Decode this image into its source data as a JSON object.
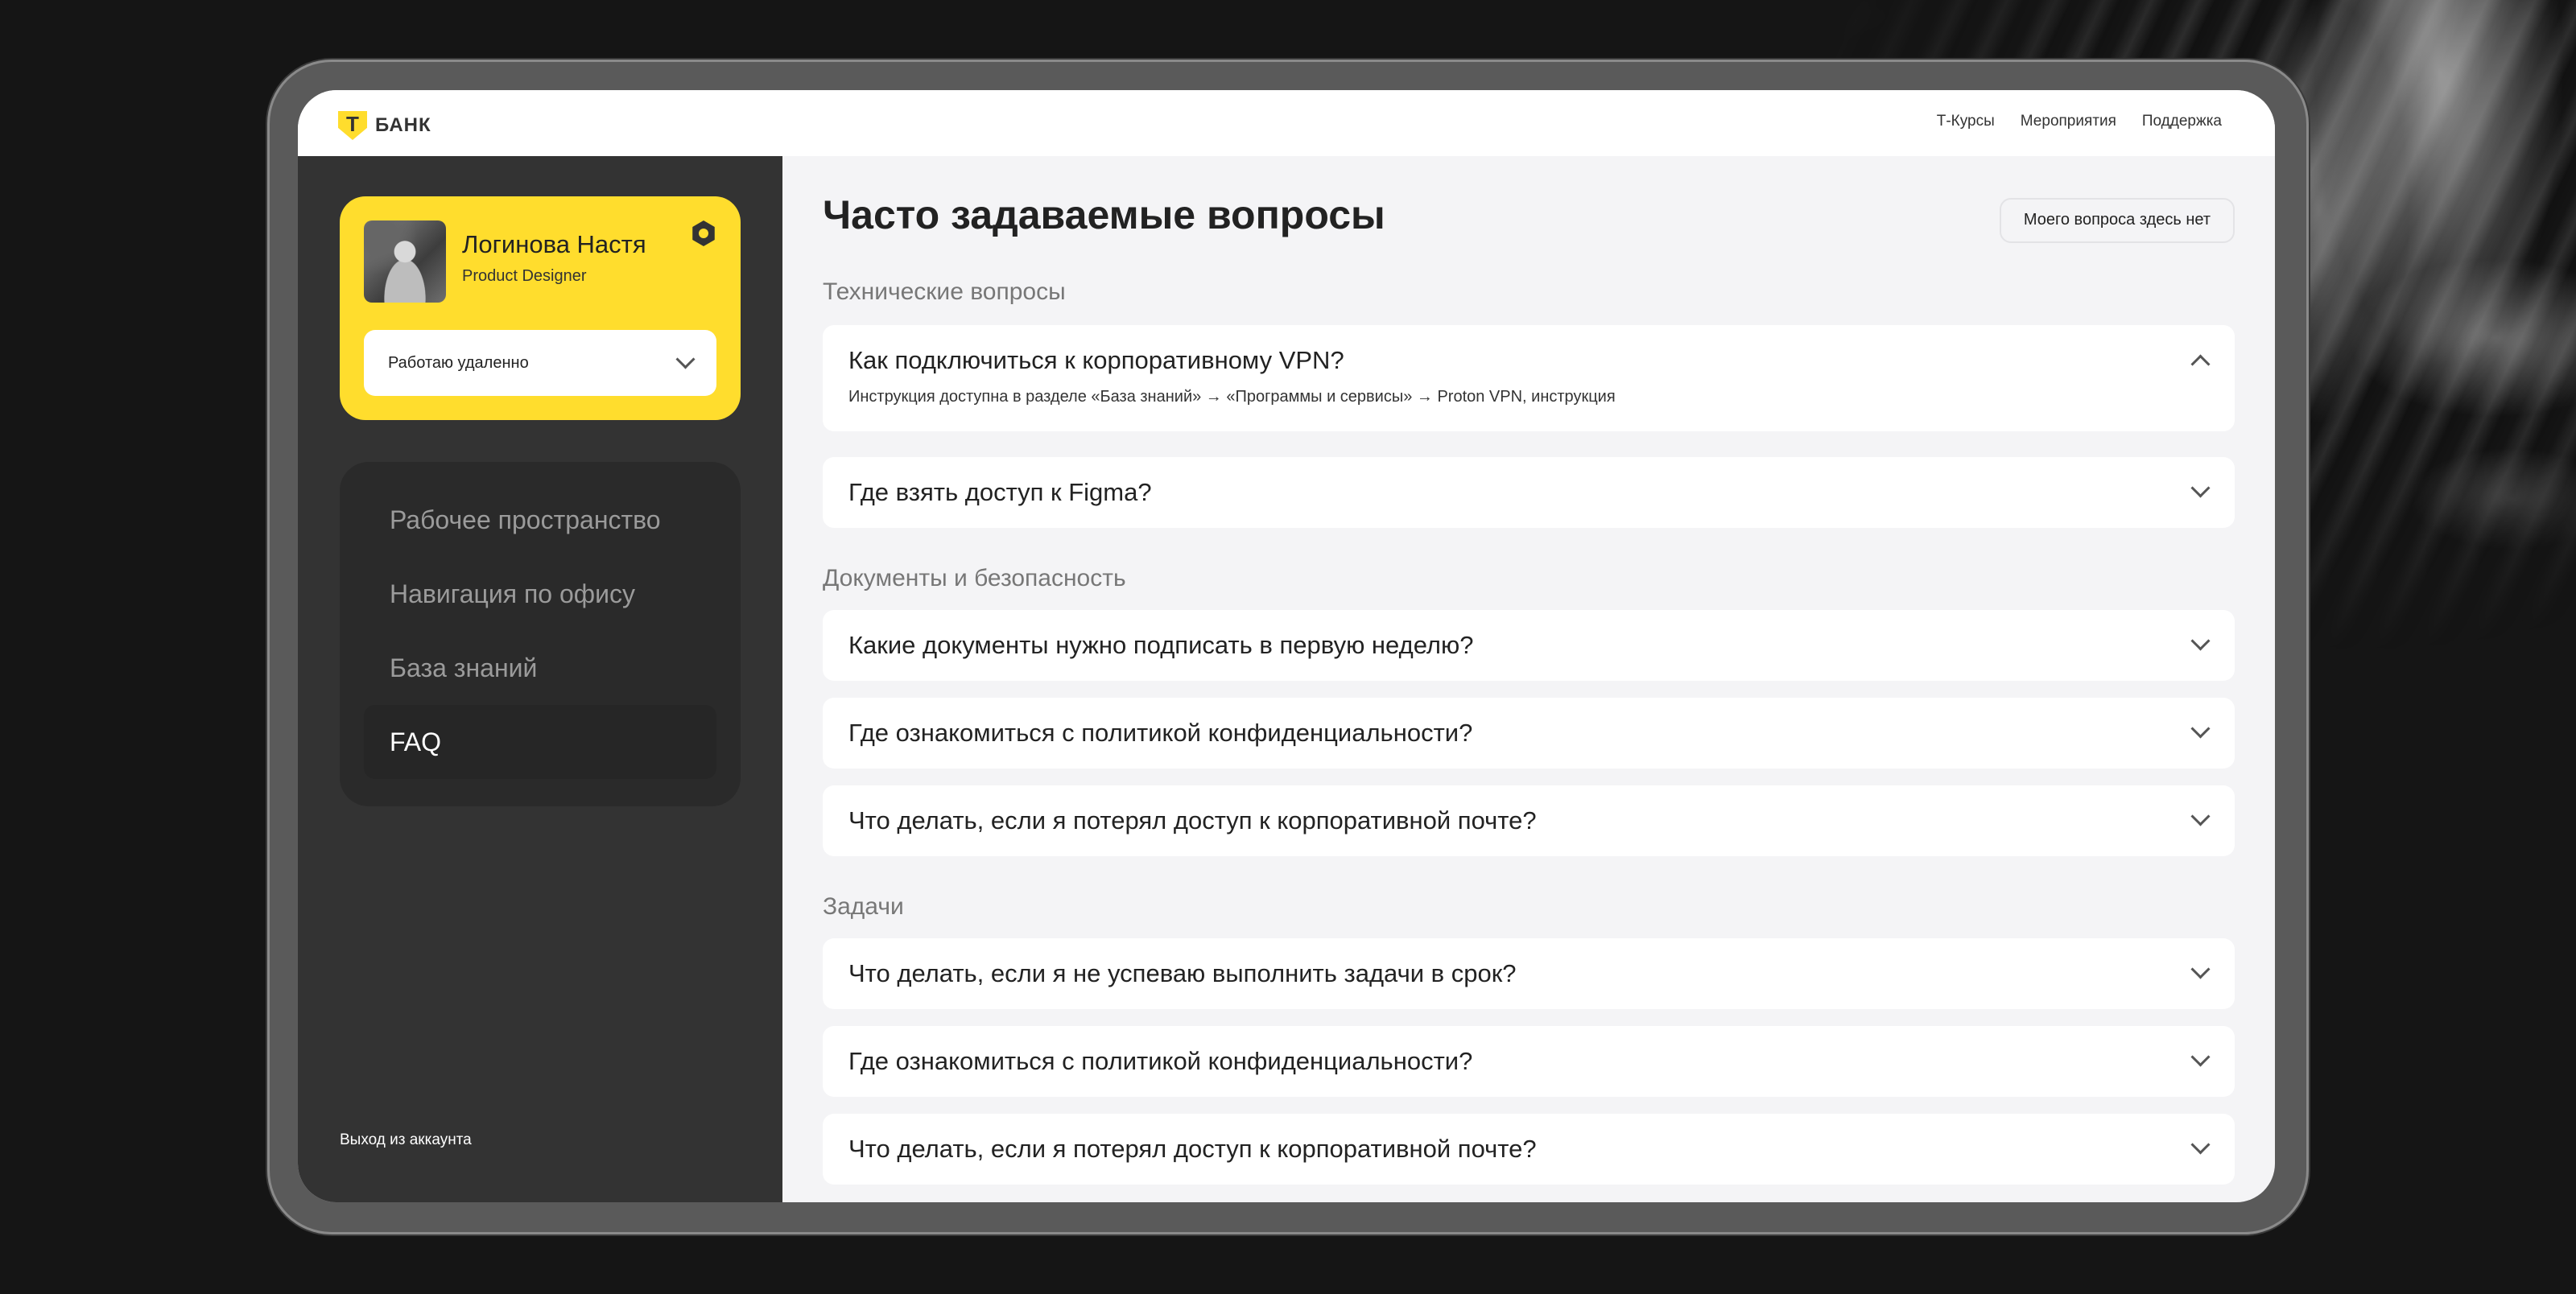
{
  "header": {
    "logo_mark": "Т",
    "logo_text": "БАНК",
    "nav": [
      "Т-Курсы",
      "Мероприятия",
      "Поддержка"
    ]
  },
  "profile": {
    "name": "Логинова Настя",
    "role": "Product Designer",
    "status_value": "Работаю удаленно"
  },
  "sidebar": {
    "items": [
      {
        "label": "Рабочее пространство",
        "active": false
      },
      {
        "label": "Навигация по офису",
        "active": false
      },
      {
        "label": "База знаний",
        "active": false
      },
      {
        "label": "FAQ",
        "active": true
      }
    ],
    "logout": "Выход из аккаунта"
  },
  "main": {
    "title": "Часто задаваемые вопросы",
    "no_question_button": "Моего вопроса здесь нет",
    "sections": [
      {
        "title": "Технические вопросы",
        "questions": [
          {
            "q": "Как подключиться к корпоративному VPN?",
            "expanded": true,
            "a": "Инструкция доступна в разделе «База знаний» → «Программы и сервисы» → Proton VPN, инструкция"
          },
          {
            "q": "Где взять доступ к Figma?",
            "expanded": false
          }
        ]
      },
      {
        "title": "Документы и безопасность",
        "questions": [
          {
            "q": "Какие документы нужно подписать в первую неделю?",
            "expanded": false
          },
          {
            "q": "Где ознакомиться с политикой конфиденциальности?",
            "expanded": false
          },
          {
            "q": "Что делать, если я потерял доступ к корпоративной почте?",
            "expanded": false
          }
        ]
      },
      {
        "title": "Задачи",
        "questions": [
          {
            "q": "Что делать, если я не успеваю выполнить задачи в срок?",
            "expanded": false
          },
          {
            "q": "Где ознакомиться с политикой конфиденциальности?",
            "expanded": false
          },
          {
            "q": "Что делать, если я потерял доступ к корпоративной почте?",
            "expanded": false
          }
        ]
      }
    ]
  },
  "colors": {
    "accent_yellow": "#ffdd2d",
    "sidebar_bg": "#333333",
    "content_bg": "#f4f4f6",
    "page_bg": "#151515"
  }
}
